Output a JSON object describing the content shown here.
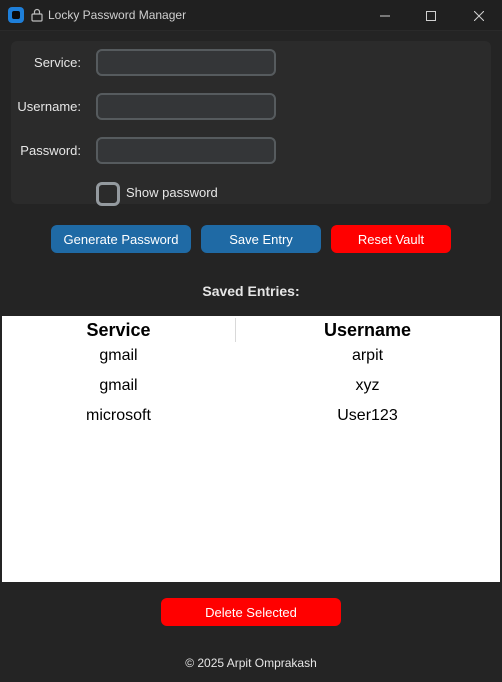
{
  "window": {
    "title": "Locky Password Manager",
    "icons": [
      "app-icon",
      "lock-icon",
      "minimize-icon",
      "maximize-icon",
      "close-icon"
    ]
  },
  "form": {
    "service_label": "Service:",
    "service_value": "",
    "username_label": "Username:",
    "username_value": "",
    "password_label": "Password:",
    "password_value": "",
    "show_password_label": "Show password",
    "show_password_checked": false
  },
  "actions": {
    "generate_label": "Generate Password",
    "save_label": "Save Entry",
    "reset_label": "Reset Vault"
  },
  "entries": {
    "title": "Saved Entries:",
    "columns": [
      "Service",
      "Username"
    ],
    "rows": [
      [
        "gmail",
        "arpit"
      ],
      [
        "gmail",
        "xyz"
      ],
      [
        "microsoft",
        "User123"
      ]
    ]
  },
  "delete_label": "Delete Selected",
  "footer": "© 2025 Arpit Omprakash",
  "colors": {
    "background": "#242424",
    "panel": "#2b2b2b",
    "accent_blue": "#1f6aa5",
    "danger_red": "#ff0000"
  }
}
